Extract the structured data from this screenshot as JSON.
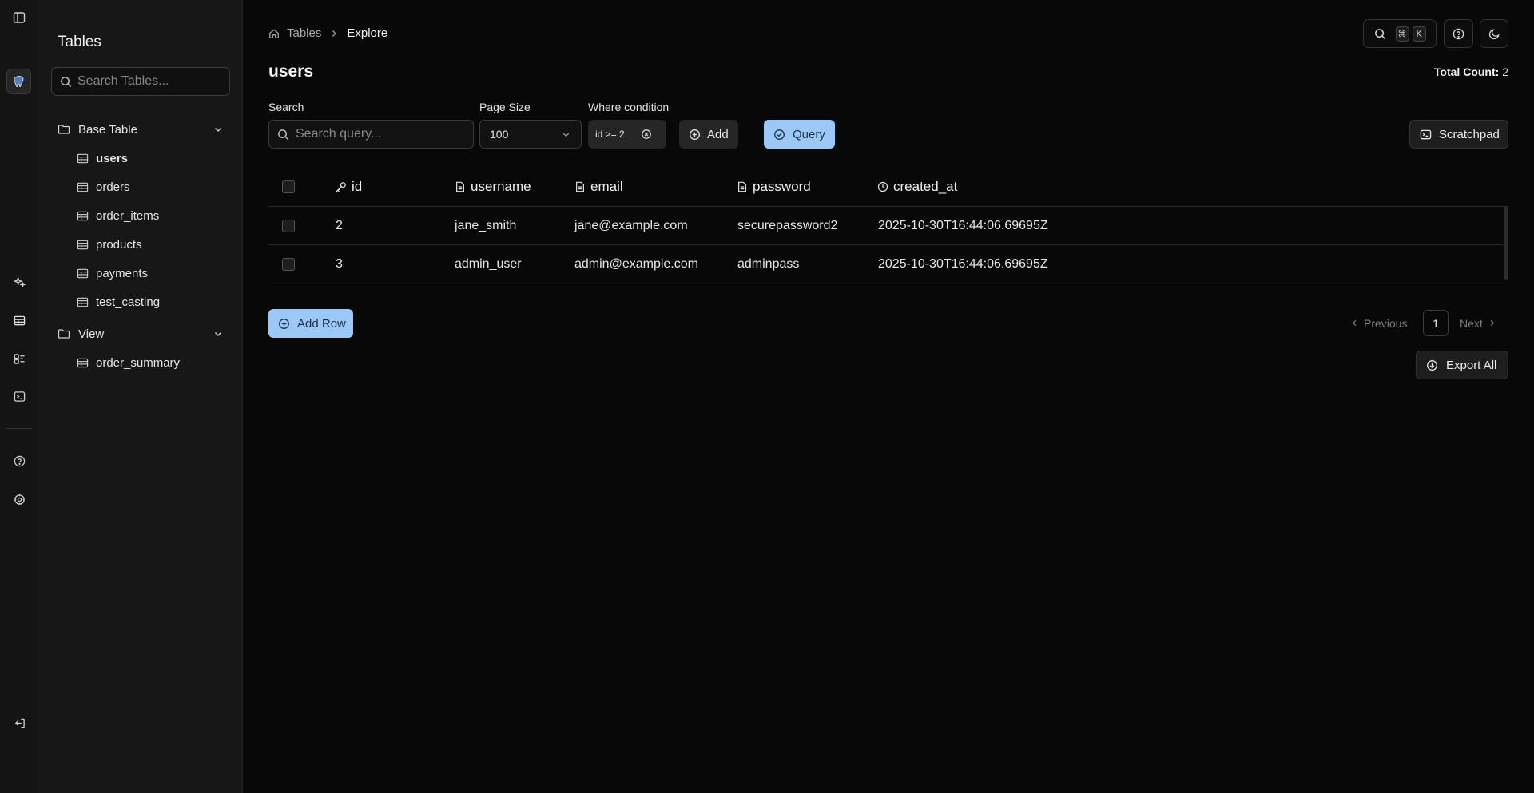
{
  "sidebar": {
    "title": "Tables",
    "search_placeholder": "Search Tables...",
    "groups": [
      {
        "label": "Base Table",
        "items": [
          "users",
          "orders",
          "order_items",
          "products",
          "payments",
          "test_casting"
        ]
      },
      {
        "label": "View",
        "items": [
          "order_summary"
        ]
      }
    ],
    "active_item": "users"
  },
  "breadcrumb": {
    "root": "Tables",
    "current": "Explore"
  },
  "toolbar": {
    "kbd_cmd": "⌘",
    "kbd_key": "K"
  },
  "page": {
    "title": "users",
    "total_count_label": "Total Count:",
    "total_count_value": "2"
  },
  "filters": {
    "search_label": "Search",
    "search_placeholder": "Search query...",
    "page_size_label": "Page Size",
    "page_size_value": "100",
    "where_label": "Where condition",
    "where_chip": "id >= 2",
    "add_label": "Add",
    "query_label": "Query",
    "scratchpad_label": "Scratchpad"
  },
  "table": {
    "columns": [
      "id",
      "username",
      "email",
      "password",
      "created_at"
    ],
    "rows": [
      [
        "2",
        "jane_smith",
        "jane@example.com",
        "securepassword2",
        "2025-10-30T16:44:06.69695Z"
      ],
      [
        "3",
        "admin_user",
        "admin@example.com",
        "adminpass",
        "2025-10-30T16:44:06.69695Z"
      ]
    ]
  },
  "actions": {
    "add_row_label": "Add Row",
    "export_all_label": "Export All"
  },
  "pagination": {
    "previous_label": "Previous",
    "current_page": "1",
    "next_label": "Next"
  },
  "colors": {
    "accent": "#9cc8f8",
    "background": "#080808",
    "sidebar": "#171717"
  }
}
